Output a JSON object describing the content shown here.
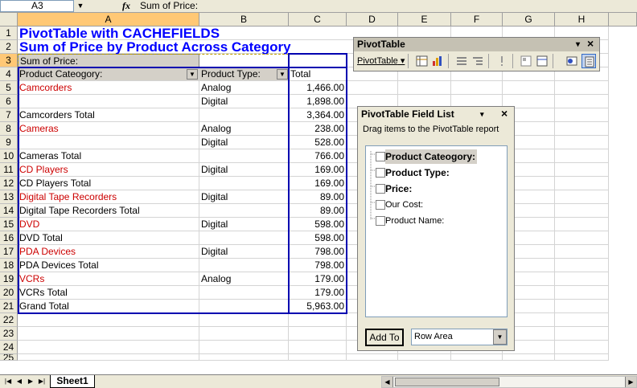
{
  "formula_bar": {
    "name_box": "A3",
    "fx": "fx",
    "formula": "Sum of Price:"
  },
  "columns": [
    "A",
    "B",
    "C",
    "D",
    "E",
    "F",
    "G",
    "H"
  ],
  "rows": [
    "1",
    "2",
    "3",
    "4",
    "5",
    "6",
    "7",
    "8",
    "9",
    "10",
    "11",
    "12",
    "13",
    "14",
    "15",
    "16",
    "17",
    "18",
    "19",
    "20",
    "21",
    "22",
    "23",
    "24",
    "25"
  ],
  "sheet": {
    "title1": "PivotTable with CACHEFIELDS",
    "title2": "Sum of Price by Product Across Category",
    "data_field": "Sum of Price:",
    "row_field1": "Product Cateogory:",
    "row_field2": "Product Type:",
    "total_header": "Total",
    "data_rows": [
      {
        "a": "Camcorders",
        "b": "Analog",
        "c": "1,466.00",
        "red": true
      },
      {
        "a": "",
        "b": "Digital",
        "c": "1,898.00",
        "red": false
      },
      {
        "a": "Camcorders Total",
        "b": "",
        "c": "3,364.00",
        "red": false
      },
      {
        "a": "Cameras",
        "b": "Analog",
        "c": "238.00",
        "red": true
      },
      {
        "a": "",
        "b": "Digital",
        "c": "528.00",
        "red": false
      },
      {
        "a": "Cameras Total",
        "b": "",
        "c": "766.00",
        "red": false
      },
      {
        "a": "CD Players",
        "b": "Digital",
        "c": "169.00",
        "red": true
      },
      {
        "a": "CD Players Total",
        "b": "",
        "c": "169.00",
        "red": false
      },
      {
        "a": "Digital Tape Recorders",
        "b": "Digital",
        "c": "89.00",
        "red": true
      },
      {
        "a": "Digital Tape Recorders Total",
        "b": "",
        "c": "89.00",
        "red": false
      },
      {
        "a": "DVD",
        "b": "Digital",
        "c": "598.00",
        "red": true
      },
      {
        "a": "DVD Total",
        "b": "",
        "c": "598.00",
        "red": false
      },
      {
        "a": "PDA Devices",
        "b": "Digital",
        "c": "798.00",
        "red": true
      },
      {
        "a": "PDA Devices Total",
        "b": "",
        "c": "798.00",
        "red": false
      },
      {
        "a": "VCRs",
        "b": "Analog",
        "c": "179.00",
        "red": true
      },
      {
        "a": "VCRs Total",
        "b": "",
        "c": "179.00",
        "red": false
      },
      {
        "a": "Grand Total",
        "b": "",
        "c": "5,963.00",
        "red": false
      }
    ]
  },
  "toolbar": {
    "title": "PivotTable",
    "menu": "PivotTable",
    "close": "×",
    "options": "▾"
  },
  "field_list": {
    "title": "PivotTable Field List",
    "close": "×",
    "hint": "Drag items to the PivotTable report",
    "fields": [
      {
        "name": "Product Cateogory:",
        "bold": true
      },
      {
        "name": "Product Type:",
        "bold": true
      },
      {
        "name": "Price:",
        "bold": true
      },
      {
        "name": "Our Cost:",
        "bold": false
      },
      {
        "name": "Product Name:",
        "bold": false
      }
    ],
    "add_to": "Add To",
    "area": "Row Area"
  },
  "sheet_tab": "Sheet1"
}
